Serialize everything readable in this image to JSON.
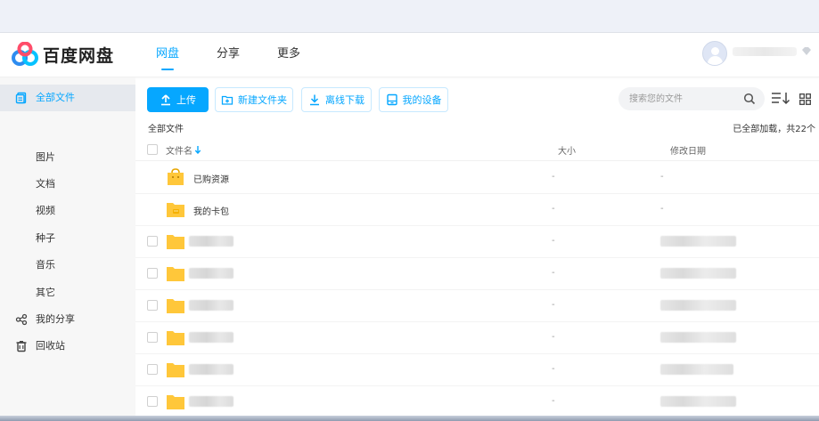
{
  "colors": {
    "accent": "#06a7ff",
    "folder": "#ffc73a",
    "sidebar_bg": "#f7f7f7"
  },
  "app": {
    "title": "百度网盘"
  },
  "nav": {
    "items": [
      "网盘",
      "分享",
      "更多"
    ],
    "active": "网盘"
  },
  "header": {
    "avatar_icon": "user-avatar-icon",
    "caret_icon": "diamond-caret-icon"
  },
  "sidebar": {
    "items": [
      {
        "label": "全部文件",
        "icon": "file-list-icon",
        "active": true
      },
      {
        "label": "图片"
      },
      {
        "label": "文档"
      },
      {
        "label": "视频"
      },
      {
        "label": "种子"
      },
      {
        "label": "音乐"
      },
      {
        "label": "其它"
      },
      {
        "label": "我的分享",
        "icon": "share-icon"
      },
      {
        "label": "回收站",
        "icon": "trash-icon"
      }
    ]
  },
  "toolbar": {
    "upload": "上传",
    "new_folder": "新建文件夹",
    "offline_download": "离线下载",
    "my_devices": "我的设备",
    "search_placeholder": "搜索您的文件"
  },
  "breadcrumb": "全部文件",
  "status": "已全部加载，共22个",
  "table": {
    "headers": {
      "name": "文件名",
      "size": "大小",
      "date": "修改日期"
    },
    "rows": [
      {
        "name": "已购资源",
        "size": "-",
        "date": "-",
        "icon": "purchased-folder-icon"
      },
      {
        "name": "我的卡包",
        "size": "-",
        "date": "-",
        "icon": "card-folder-icon"
      },
      {
        "name": "",
        "size": "-",
        "date": "",
        "icon": "folder-icon"
      },
      {
        "name": "",
        "size": "-",
        "date": "",
        "icon": "folder-icon"
      },
      {
        "name": "",
        "size": "-",
        "date": "",
        "icon": "folder-icon"
      },
      {
        "name": "",
        "size": "-",
        "date": "",
        "icon": "folder-icon"
      },
      {
        "name": "",
        "size": "-",
        "date": "",
        "icon": "folder-icon"
      },
      {
        "name": "",
        "size": "-",
        "date": "",
        "icon": "folder-icon"
      }
    ]
  }
}
